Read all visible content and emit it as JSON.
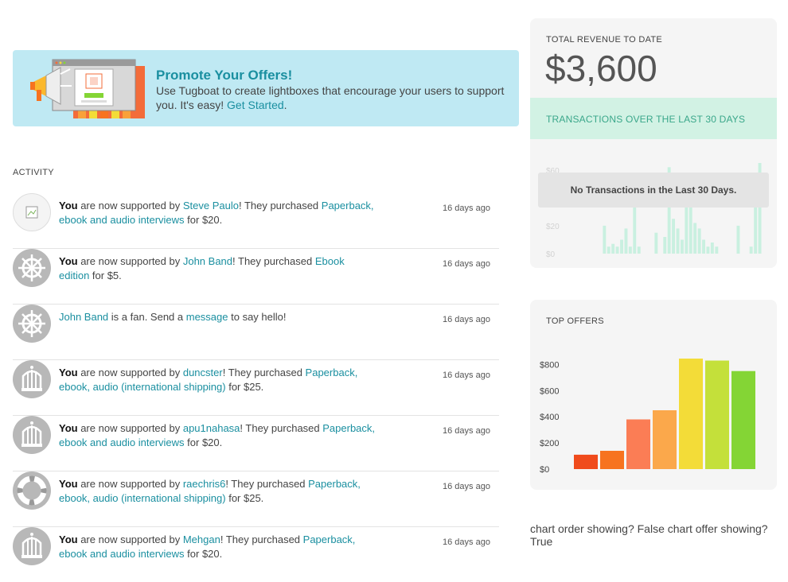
{
  "promo": {
    "title": "Promote Your Offers!",
    "body": "Use Tugboat to create lightboxes that encourage your users to support you. It's easy!",
    "cta": "Get Started",
    "end": "."
  },
  "activity": {
    "label": "ACTIVITY",
    "items": [
      {
        "avatar": "broken-image-icon",
        "you": "You",
        "pre": " are now supported by ",
        "user": "Steve Paulo",
        "mid": "! They purchased ",
        "offer": "Paperback, ebook and audio interviews",
        "post": " for $20.",
        "time": "16 days ago"
      },
      {
        "avatar": "ship-wheel-icon",
        "you": "You",
        "pre": " are now supported by ",
        "user": "John Band",
        "mid": "! They purchased ",
        "offer": "Ebook edition",
        "post": " for $5.",
        "time": "16 days ago"
      },
      {
        "avatar": "ship-wheel-icon",
        "you": "",
        "pre": "",
        "user": "John Band",
        "mid": " is a fan. Send a ",
        "offer": "message",
        "post": " to say hello!",
        "time": "16 days ago"
      },
      {
        "avatar": "birdcage-icon",
        "you": "You",
        "pre": " are now supported by ",
        "user": "duncster",
        "mid": "! They purchased ",
        "offer": "Paperback, ebook, audio (international shipping)",
        "post": " for $25.",
        "time": "16 days ago"
      },
      {
        "avatar": "birdcage-icon",
        "you": "You",
        "pre": " are now supported by ",
        "user": "apu1nahasa",
        "mid": "! They purchased ",
        "offer": "Paperback, ebook and audio interviews",
        "post": " for $20.",
        "time": "16 days ago"
      },
      {
        "avatar": "life-ring-icon",
        "you": "You",
        "pre": " are now supported by ",
        "user": "raechris6",
        "mid": "! They purchased ",
        "offer": "Paperback, ebook, audio (international shipping)",
        "post": " for $25.",
        "time": "16 days ago"
      },
      {
        "avatar": "birdcage-icon",
        "you": "You",
        "pre": " are now supported by ",
        "user": "Mehgan",
        "mid": "! They purchased ",
        "offer": "Paperback, ebook and audio interviews",
        "post": " for $20.",
        "time": "16 days ago"
      }
    ]
  },
  "revenue": {
    "label": "TOTAL REVENUE TO DATE",
    "amount": "$3,600",
    "transactions_label": "TRANSACTIONS OVER THE LAST 30 DAYS",
    "no_transactions": "No Transactions in the Last 30 Days."
  },
  "top_offers": {
    "title": "TOP OFFERS"
  },
  "debug_text": "chart order showing? False chart offer showing? True",
  "chart_data": [
    {
      "type": "bar",
      "title": "TRANSACTIONS OVER THE LAST 30 DAYS",
      "y_ticks": [
        "$0",
        "$20",
        "$40",
        "$60"
      ],
      "ylim": [
        0,
        65
      ],
      "values": [
        0,
        0,
        0,
        0,
        0,
        0,
        0,
        0,
        20,
        5,
        7,
        5,
        10,
        18,
        5,
        35,
        5,
        0,
        0,
        0,
        15,
        0,
        12,
        62,
        25,
        18,
        10,
        58,
        45,
        22,
        18,
        10,
        5,
        8,
        5,
        0,
        0,
        0,
        0,
        20,
        0,
        0,
        5,
        38,
        65
      ],
      "color": "#c9f0e0",
      "grid": false
    },
    {
      "type": "bar",
      "title": "TOP OFFERS",
      "y_ticks": [
        "$0",
        "$200",
        "$400",
        "$600",
        "$800"
      ],
      "ylim": [
        0,
        900
      ],
      "values": [
        110,
        140,
        380,
        450,
        845,
        830,
        750
      ],
      "colors": [
        "#f04b1c",
        "#f7731f",
        "#fb7d55",
        "#fba84b",
        "#f3dc38",
        "#c4e03a",
        "#84d535"
      ],
      "grid": false
    }
  ]
}
